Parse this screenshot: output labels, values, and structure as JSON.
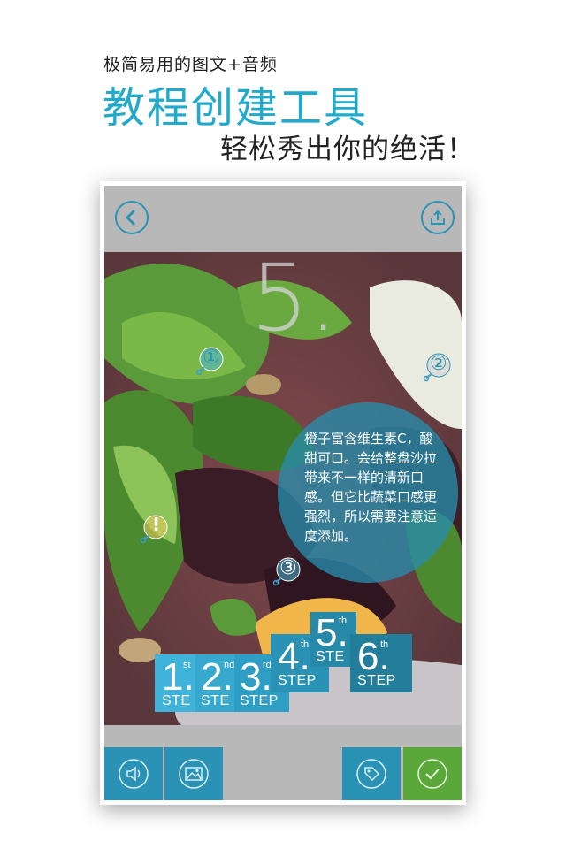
{
  "headline": {
    "small": "极简易用的图文+音频",
    "big": "教程创建工具",
    "tagline": "轻松秀出你的绝活！"
  },
  "step_number": "5.",
  "markers": [
    "①",
    "②",
    "!",
    "③"
  ],
  "info_text": "橙子富含维生素C，酸甜可口。会给整盘沙拉带来不一样的清新口感。但它比蔬菜口感更强烈，所以需要注意适度添加。",
  "steps": [
    {
      "num": "1.",
      "sup": "st",
      "label": "STE"
    },
    {
      "num": "2.",
      "sup": "nd",
      "label": "STE"
    },
    {
      "num": "3.",
      "sup": "rd",
      "label": "STEP"
    },
    {
      "num": "4.",
      "sup": "th",
      "label": "STEP"
    },
    {
      "num": "5.",
      "sup": "th",
      "label": "STE"
    },
    {
      "num": "6.",
      "sup": "th",
      "label": "STEP"
    }
  ],
  "colors": {
    "accent": "#22aacd",
    "button_teal": "#2a93b5",
    "confirm_green": "#5aa83a"
  },
  "icons": {
    "back": "chevron-left-icon",
    "share": "share-icon",
    "audio": "speaker-icon",
    "image": "image-icon",
    "tag": "tag-icon",
    "confirm": "check-icon"
  }
}
